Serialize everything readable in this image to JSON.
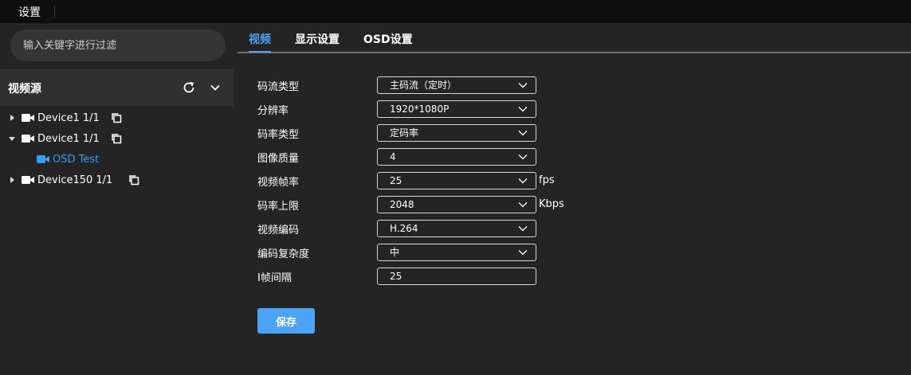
{
  "app": {
    "title": "设置"
  },
  "sidebar": {
    "search_placeholder": "输入关键字进行过滤",
    "section_title": "视频源",
    "tree": [
      {
        "label": "Device1 1/1",
        "expanded": false
      },
      {
        "label": "Device1 1/1",
        "expanded": true
      },
      {
        "label": "OSD Test",
        "child": true
      },
      {
        "label": "Device150 1/1",
        "expanded": false
      }
    ]
  },
  "tabs": [
    {
      "label": "视频",
      "active": true
    },
    {
      "label": "显示设置",
      "active": false
    },
    {
      "label": "OSD设置",
      "active": false
    }
  ],
  "form": {
    "fields": [
      {
        "label": "码流类型",
        "value": "主码流（定时）",
        "type": "select"
      },
      {
        "label": "分辨率",
        "value": "1920*1080P",
        "type": "select"
      },
      {
        "label": "码率类型",
        "value": "定码率",
        "type": "select"
      },
      {
        "label": "图像质量",
        "value": "4",
        "type": "select"
      },
      {
        "label": "视频帧率",
        "value": "25",
        "type": "select",
        "unit": "fps"
      },
      {
        "label": "码率上限",
        "value": "2048",
        "type": "select",
        "unit": "Kbps"
      },
      {
        "label": "视频编码",
        "value": "H.264",
        "type": "select"
      },
      {
        "label": "编码复杂度",
        "value": "中",
        "type": "select"
      },
      {
        "label": "I帧间隔",
        "value": "25",
        "type": "input"
      }
    ],
    "save_label": "保存"
  },
  "colors": {
    "accent": "#4aa3f5",
    "background": "#242424",
    "topbar": "#0f0f0f"
  }
}
